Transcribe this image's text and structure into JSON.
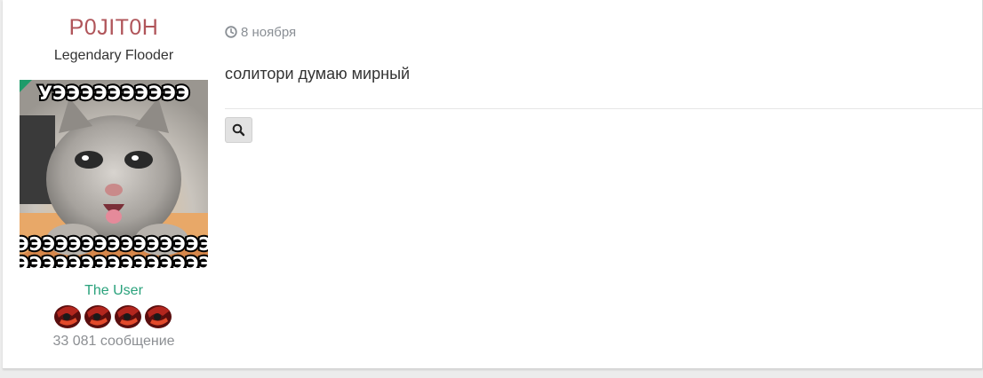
{
  "author": {
    "username": "P0JIT0H",
    "title": "Legendary Flooder",
    "avatar_caption_top": "УЭЭЭЭЭЭЭЭЭЭ",
    "avatar_caption_bottom": "ЭЭЭЭЭЭЭЭЭЭЭЭЭЭЭ",
    "group": "The User",
    "message_count": "33 081 сообщение",
    "online_color": "#1e9b6a",
    "reputation_icons": [
      "reputation-icon",
      "reputation-icon",
      "reputation-icon",
      "reputation-icon"
    ]
  },
  "post": {
    "date": "8 ноября",
    "text": "солитори думаю мирный",
    "search_icon": "search-icon"
  },
  "colors": {
    "username": "#b0555a",
    "group": "#2aa27c",
    "muted": "#8c8f93"
  }
}
